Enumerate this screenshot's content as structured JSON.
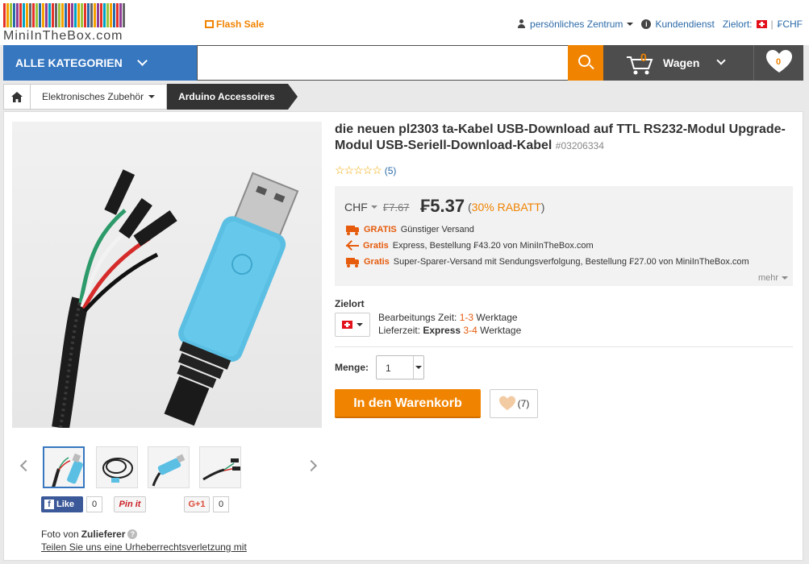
{
  "header": {
    "logo_text": "MiniInTheBox.com",
    "flash_sale": "Flash Sale",
    "account": "persönliches Zentrum",
    "service": "Kundendienst",
    "destination_label": "Zielort:",
    "separator": "|",
    "currency": "₣CHF"
  },
  "nav": {
    "all_categories": "ALLE KATEGORIEN",
    "search_placeholder": "",
    "cart_count": "0",
    "cart_label": "Wagen",
    "wishlist_count": "0"
  },
  "breadcrumb": {
    "items": [
      "Elektronisches Zubehör"
    ],
    "current": "Arduino Accessoires"
  },
  "product": {
    "title": "die neuen pl2303 ta-Kabel USB-Download auf TTL RS232-Modul Upgrade-Modul USB-Seriell-Download-Kabel",
    "sku": "#03206334",
    "rating_stars": "☆☆☆☆☆",
    "rating_count": "(5)",
    "currency": "CHF",
    "old_price": "₣7.67",
    "new_price": "₣5.37",
    "discount_open": "(",
    "discount": "30% RABATT",
    "discount_close": ")",
    "shipping": [
      {
        "highlight": "GRATIS",
        "text": "Günstiger Versand"
      },
      {
        "highlight": "Gratis",
        "text": "Express, Bestellung ₣43.20 von MiniInTheBox.com"
      },
      {
        "highlight": "Gratis",
        "text": "Super-Sparer-Versand mit Sendungsverfolgung, Bestellung ₣27.00 von MiniInTheBox.com"
      }
    ],
    "more": "mehr",
    "destination_label": "Zielort",
    "processing_label": "Bearbeitungs Zeit:",
    "processing_value": "1-3",
    "processing_unit": "Werktage",
    "delivery_label": "Lieferzeit:",
    "delivery_express": "Express",
    "delivery_value": "3-4",
    "delivery_unit": "Werktage",
    "quantity_label": "Menge:",
    "quantity_value": "1",
    "add_to_cart": "In den Warenkorb",
    "wish_count": "(7)"
  },
  "social": {
    "fb_letter": "f",
    "like_label": "Like",
    "like_count": "0",
    "pin_label": "Pin it",
    "gplus_label": "G+1",
    "gplus_count": "0"
  },
  "photo": {
    "by_label": "Foto von",
    "by_value": "Zulieferer",
    "report_link": "Teilen Sie uns eine Urheberrechtsverletzung mit"
  },
  "colors": {
    "accent_orange": "#f08300",
    "nav_blue": "#3677c0",
    "nav_dark": "#4d4d4d",
    "cable_blue": "#5bbfe3"
  }
}
